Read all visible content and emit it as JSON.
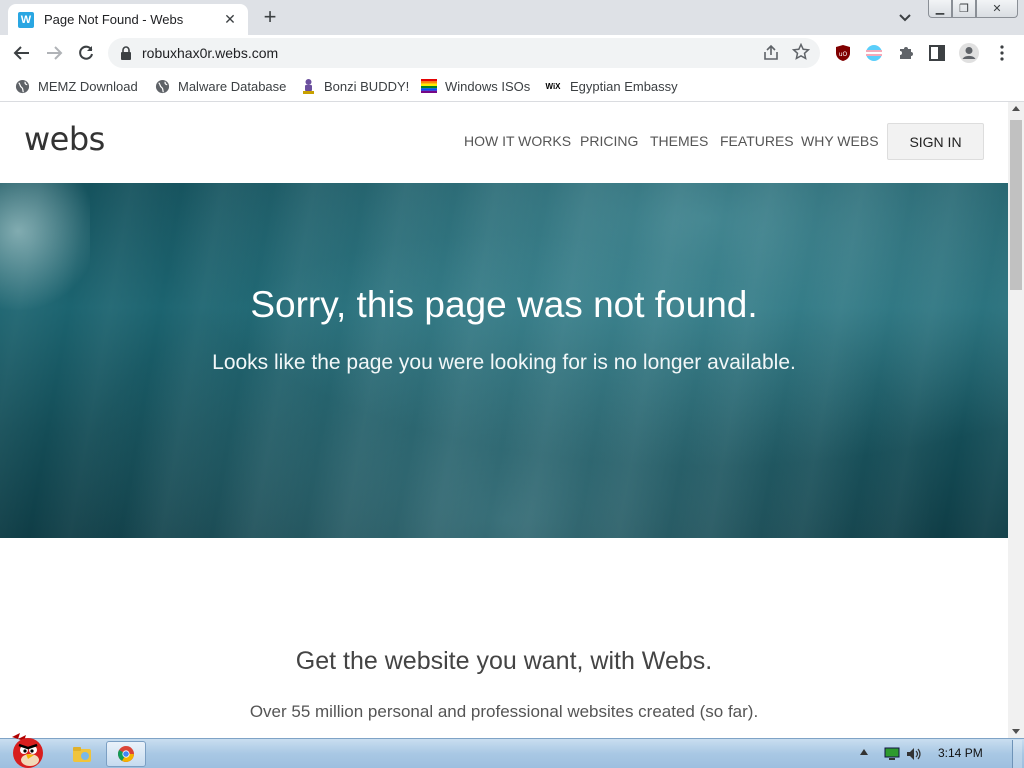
{
  "browser": {
    "tab": {
      "title": "Page Not Found - Webs",
      "favicon_letter": "W"
    },
    "address_bar": {
      "url": "robuxhax0r.webs.com"
    },
    "bookmarks": [
      {
        "label": "MEMZ Download",
        "icon": "globe-icon"
      },
      {
        "label": "Malware Database",
        "icon": "globe-icon"
      },
      {
        "label": "Bonzi BUDDY!",
        "icon": "bonzi-icon"
      },
      {
        "label": "Windows ISOs",
        "icon": "rainbow-flag-icon"
      },
      {
        "label": "Egyptian Embassy",
        "icon": "wix-icon",
        "icon_text": "WiX"
      }
    ]
  },
  "site": {
    "logo": "webs",
    "nav": [
      "HOW IT WORKS",
      "PRICING",
      "THEMES",
      "FEATURES",
      "WHY WEBS"
    ],
    "signin_label": "SIGN IN",
    "hero": {
      "title": "Sorry, this page was not found.",
      "subtitle": "Looks like the page you were looking for is no longer available."
    },
    "promo": {
      "title": "Get the website you want, with Webs.",
      "subtitle": "Over 55 million personal and professional websites created (so far)."
    }
  },
  "taskbar": {
    "time": "3:14 PM"
  },
  "colors": {
    "tab_strip": "#dee1e6",
    "hero_teal": "#1c6470",
    "taskbar": "#a9c8e4"
  }
}
